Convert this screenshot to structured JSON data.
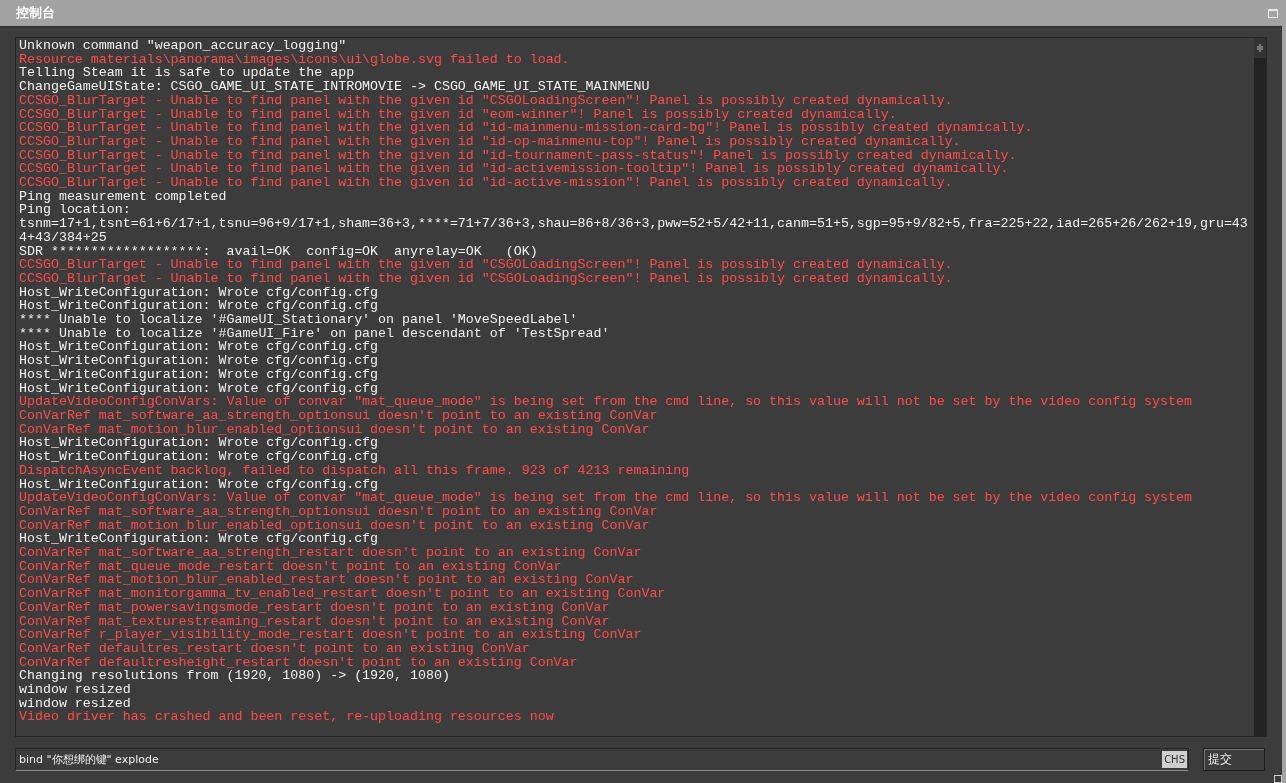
{
  "window": {
    "title": "控制台"
  },
  "log": [
    {
      "kind": "normal",
      "text": "Unknown command \"weapon_accuracy_logging\""
    },
    {
      "kind": "error",
      "text": "Resource materials\\panorama\\images\\icons\\ui\\globe.svg failed to load."
    },
    {
      "kind": "normal",
      "text": "Telling Steam it is safe to update the app"
    },
    {
      "kind": "normal",
      "text": "ChangeGameUIState: CSGO_GAME_UI_STATE_INTROMOVIE -> CSGO_GAME_UI_STATE_MAINMENU"
    },
    {
      "kind": "error",
      "text": "CCSGO_BlurTarget - Unable to find panel with the given id \"CSGOLoadingScreen\"! Panel is possibly created dynamically."
    },
    {
      "kind": "error",
      "text": "CCSGO_BlurTarget - Unable to find panel with the given id \"eom-winner\"! Panel is possibly created dynamically."
    },
    {
      "kind": "error",
      "text": "CCSGO_BlurTarget - Unable to find panel with the given id \"id-mainmenu-mission-card-bg\"! Panel is possibly created dynamically."
    },
    {
      "kind": "error",
      "text": "CCSGO_BlurTarget - Unable to find panel with the given id \"id-op-mainmenu-top\"! Panel is possibly created dynamically."
    },
    {
      "kind": "error",
      "text": "CCSGO_BlurTarget - Unable to find panel with the given id \"id-tournament-pass-status\"! Panel is possibly created dynamically."
    },
    {
      "kind": "error",
      "text": "CCSGO_BlurTarget - Unable to find panel with the given id \"id-activemission-tooltip\"! Panel is possibly created dynamically."
    },
    {
      "kind": "error",
      "text": "CCSGO_BlurTarget - Unable to find panel with the given id \"id-active-mission\"! Panel is possibly created dynamically."
    },
    {
      "kind": "normal",
      "text": "Ping measurement completed"
    },
    {
      "kind": "normal",
      "text": "Ping location:"
    },
    {
      "kind": "normal",
      "text": "tsnm=17+1,tsnt=61+6/17+1,tsnu=96+9/17+1,sham=36+3,****=71+7/36+3,shau=86+8/36+3,pww=52+5/42+11,canm=51+5,sgp=95+9/82+5,fra=225+22,iad=265+26/262+19,gru=434+43/384+25"
    },
    {
      "kind": "normal",
      "text": "SDR *******************:  avail=OK  config=OK  anyrelay=OK   (OK)"
    },
    {
      "kind": "error",
      "text": "CCSGO_BlurTarget - Unable to find panel with the given id \"CSGOLoadingScreen\"! Panel is possibly created dynamically."
    },
    {
      "kind": "error",
      "text": "CCSGO_BlurTarget - Unable to find panel with the given id \"CSGOLoadingScreen\"! Panel is possibly created dynamically."
    },
    {
      "kind": "normal",
      "text": "Host_WriteConfiguration: Wrote cfg/config.cfg"
    },
    {
      "kind": "normal",
      "text": "Host_WriteConfiguration: Wrote cfg/config.cfg"
    },
    {
      "kind": "normal",
      "text": "**** Unable to localize '#GameUI_Stationary' on panel 'MoveSpeedLabel'"
    },
    {
      "kind": "normal",
      "text": "**** Unable to localize '#GameUI_Fire' on panel descendant of 'TestSpread'"
    },
    {
      "kind": "normal",
      "text": "Host_WriteConfiguration: Wrote cfg/config.cfg"
    },
    {
      "kind": "normal",
      "text": "Host_WriteConfiguration: Wrote cfg/config.cfg"
    },
    {
      "kind": "normal",
      "text": "Host_WriteConfiguration: Wrote cfg/config.cfg"
    },
    {
      "kind": "normal",
      "text": "Host_WriteConfiguration: Wrote cfg/config.cfg"
    },
    {
      "kind": "error",
      "text": "UpdateVideoConfigConVars: Value of convar \"mat_queue_mode\" is being set from the cmd line, so this value will not be set by the video config system"
    },
    {
      "kind": "error",
      "text": "ConVarRef mat_software_aa_strength_optionsui doesn't point to an existing ConVar"
    },
    {
      "kind": "error",
      "text": "ConVarRef mat_motion_blur_enabled_optionsui doesn't point to an existing ConVar"
    },
    {
      "kind": "normal",
      "text": "Host_WriteConfiguration: Wrote cfg/config.cfg"
    },
    {
      "kind": "normal",
      "text": "Host_WriteConfiguration: Wrote cfg/config.cfg"
    },
    {
      "kind": "error",
      "text": "DispatchAsyncEvent backlog, failed to dispatch all this frame. 923 of 4213 remaining"
    },
    {
      "kind": "normal",
      "text": "Host_WriteConfiguration: Wrote cfg/config.cfg"
    },
    {
      "kind": "error",
      "text": "UpdateVideoConfigConVars: Value of convar \"mat_queue_mode\" is being set from the cmd line, so this value will not be set by the video config system"
    },
    {
      "kind": "error",
      "text": "ConVarRef mat_software_aa_strength_optionsui doesn't point to an existing ConVar"
    },
    {
      "kind": "error",
      "text": "ConVarRef mat_motion_blur_enabled_optionsui doesn't point to an existing ConVar"
    },
    {
      "kind": "normal",
      "text": "Host_WriteConfiguration: Wrote cfg/config.cfg"
    },
    {
      "kind": "error",
      "text": "ConVarRef mat_software_aa_strength_restart doesn't point to an existing ConVar"
    },
    {
      "kind": "error",
      "text": "ConVarRef mat_queue_mode_restart doesn't point to an existing ConVar"
    },
    {
      "kind": "error",
      "text": "ConVarRef mat_motion_blur_enabled_restart doesn't point to an existing ConVar"
    },
    {
      "kind": "error",
      "text": "ConVarRef mat_monitorgamma_tv_enabled_restart doesn't point to an existing ConVar"
    },
    {
      "kind": "error",
      "text": "ConVarRef mat_powersavingsmode_restart doesn't point to an existing ConVar"
    },
    {
      "kind": "error",
      "text": "ConVarRef mat_texturestreaming_restart doesn't point to an existing ConVar"
    },
    {
      "kind": "error",
      "text": "ConVarRef r_player_visibility_mode_restart doesn't point to an existing ConVar"
    },
    {
      "kind": "error",
      "text": "ConVarRef defaultres_restart doesn't point to an existing ConVar"
    },
    {
      "kind": "error",
      "text": "ConVarRef defaultresheight_restart doesn't point to an existing ConVar"
    },
    {
      "kind": "normal",
      "text": "Changing resolutions from (1920, 1080) -> (1920, 1080)"
    },
    {
      "kind": "normal",
      "text": "window resized"
    },
    {
      "kind": "normal",
      "text": "window resized"
    },
    {
      "kind": "error",
      "text": "Video driver has crashed and been reset, re-uploading resources now"
    }
  ],
  "command": {
    "value": "bind \"你想绑的键\" explode",
    "ime": "CHS"
  },
  "submit_button": "提交"
}
